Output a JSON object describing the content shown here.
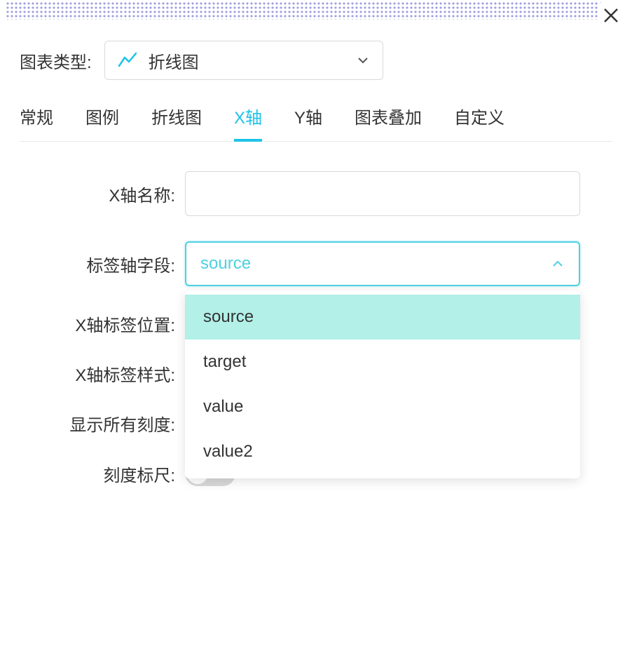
{
  "header": {
    "close_icon": "close"
  },
  "top": {
    "label": "图表类型:",
    "selected": "折线图"
  },
  "tabs": [
    {
      "label": "常规",
      "active": false
    },
    {
      "label": "图例",
      "active": false
    },
    {
      "label": "折线图",
      "active": false
    },
    {
      "label": "X轴",
      "active": true
    },
    {
      "label": "Y轴",
      "active": false
    },
    {
      "label": "图表叠加",
      "active": false
    },
    {
      "label": "自定义",
      "active": false
    }
  ],
  "form": {
    "xaxis_name": {
      "label": "X轴名称:",
      "value": ""
    },
    "label_field": {
      "label": "标签轴字段:",
      "value": "source",
      "options": [
        "source",
        "target",
        "value",
        "value2"
      ]
    },
    "xaxis_label_pos": {
      "label": "X轴标签位置:"
    },
    "xaxis_label_style": {
      "label": "X轴标签样式:"
    },
    "show_all_ticks": {
      "label": "显示所有刻度:"
    },
    "scale_ruler": {
      "label": "刻度标尺:",
      "on": false
    }
  }
}
